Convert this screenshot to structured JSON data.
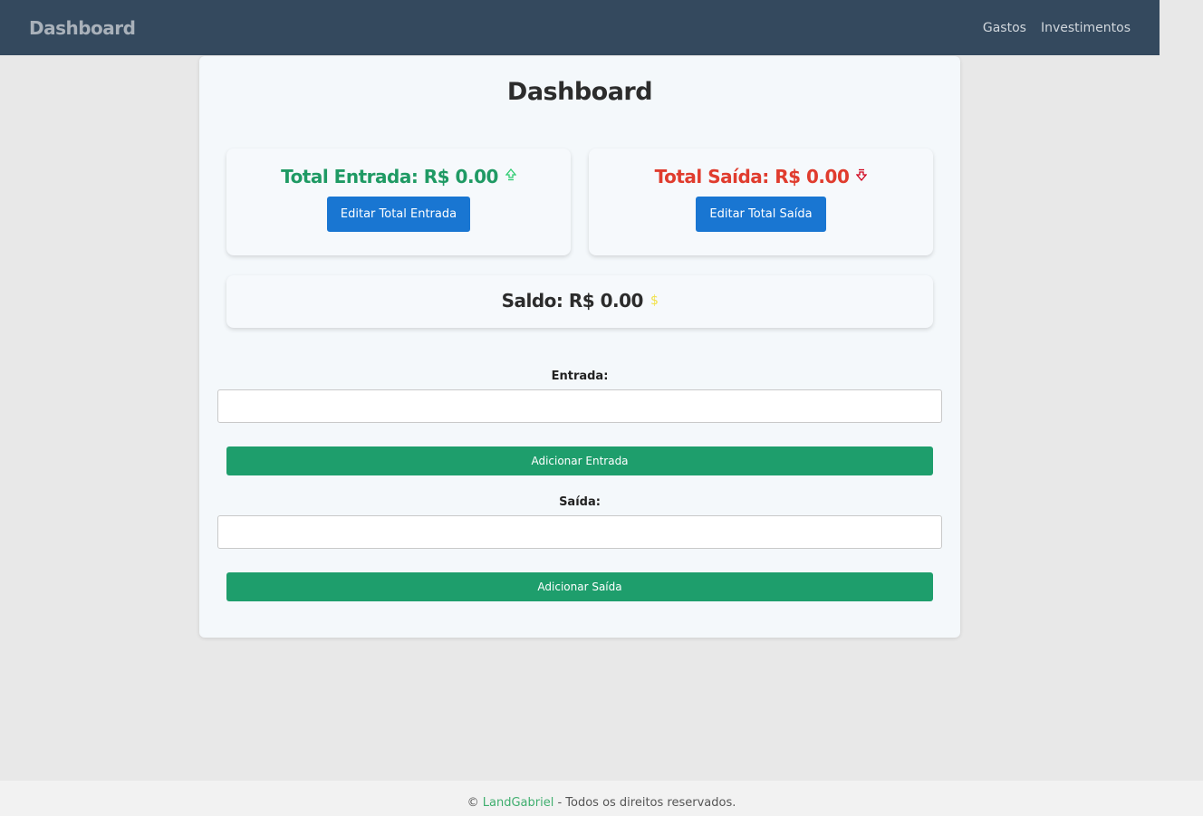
{
  "navbar": {
    "brand": "Dashboard",
    "links": [
      "Gastos",
      "Investimentos"
    ]
  },
  "main": {
    "title": "Dashboard",
    "total_entrada": {
      "label": "Total Entrada: R$ 0.00",
      "icon": "arrow-up-icon",
      "button": "Editar Total Entrada"
    },
    "total_saida": {
      "label": "Total Saída: R$ 0.00",
      "icon": "arrow-down-icon",
      "button": "Editar Total Saída"
    },
    "saldo": {
      "label": "Saldo: R$ 0.00",
      "icon": "dollar-icon"
    },
    "form": {
      "entrada_label": "Entrada:",
      "entrada_value": "",
      "entrada_button": "Adicionar Entrada",
      "saida_label": "Saída:",
      "saida_value": "",
      "saida_button": "Adicionar Saída"
    }
  },
  "footer": {
    "copyright": "©",
    "link": "LandGabriel",
    "text": "- Todos os direitos reservados."
  },
  "colors": {
    "navbar": "#34495e",
    "green": "#1f9a64",
    "red": "#e03c2e",
    "blue_button": "#1976d2",
    "green_button": "#1e9e6c"
  }
}
